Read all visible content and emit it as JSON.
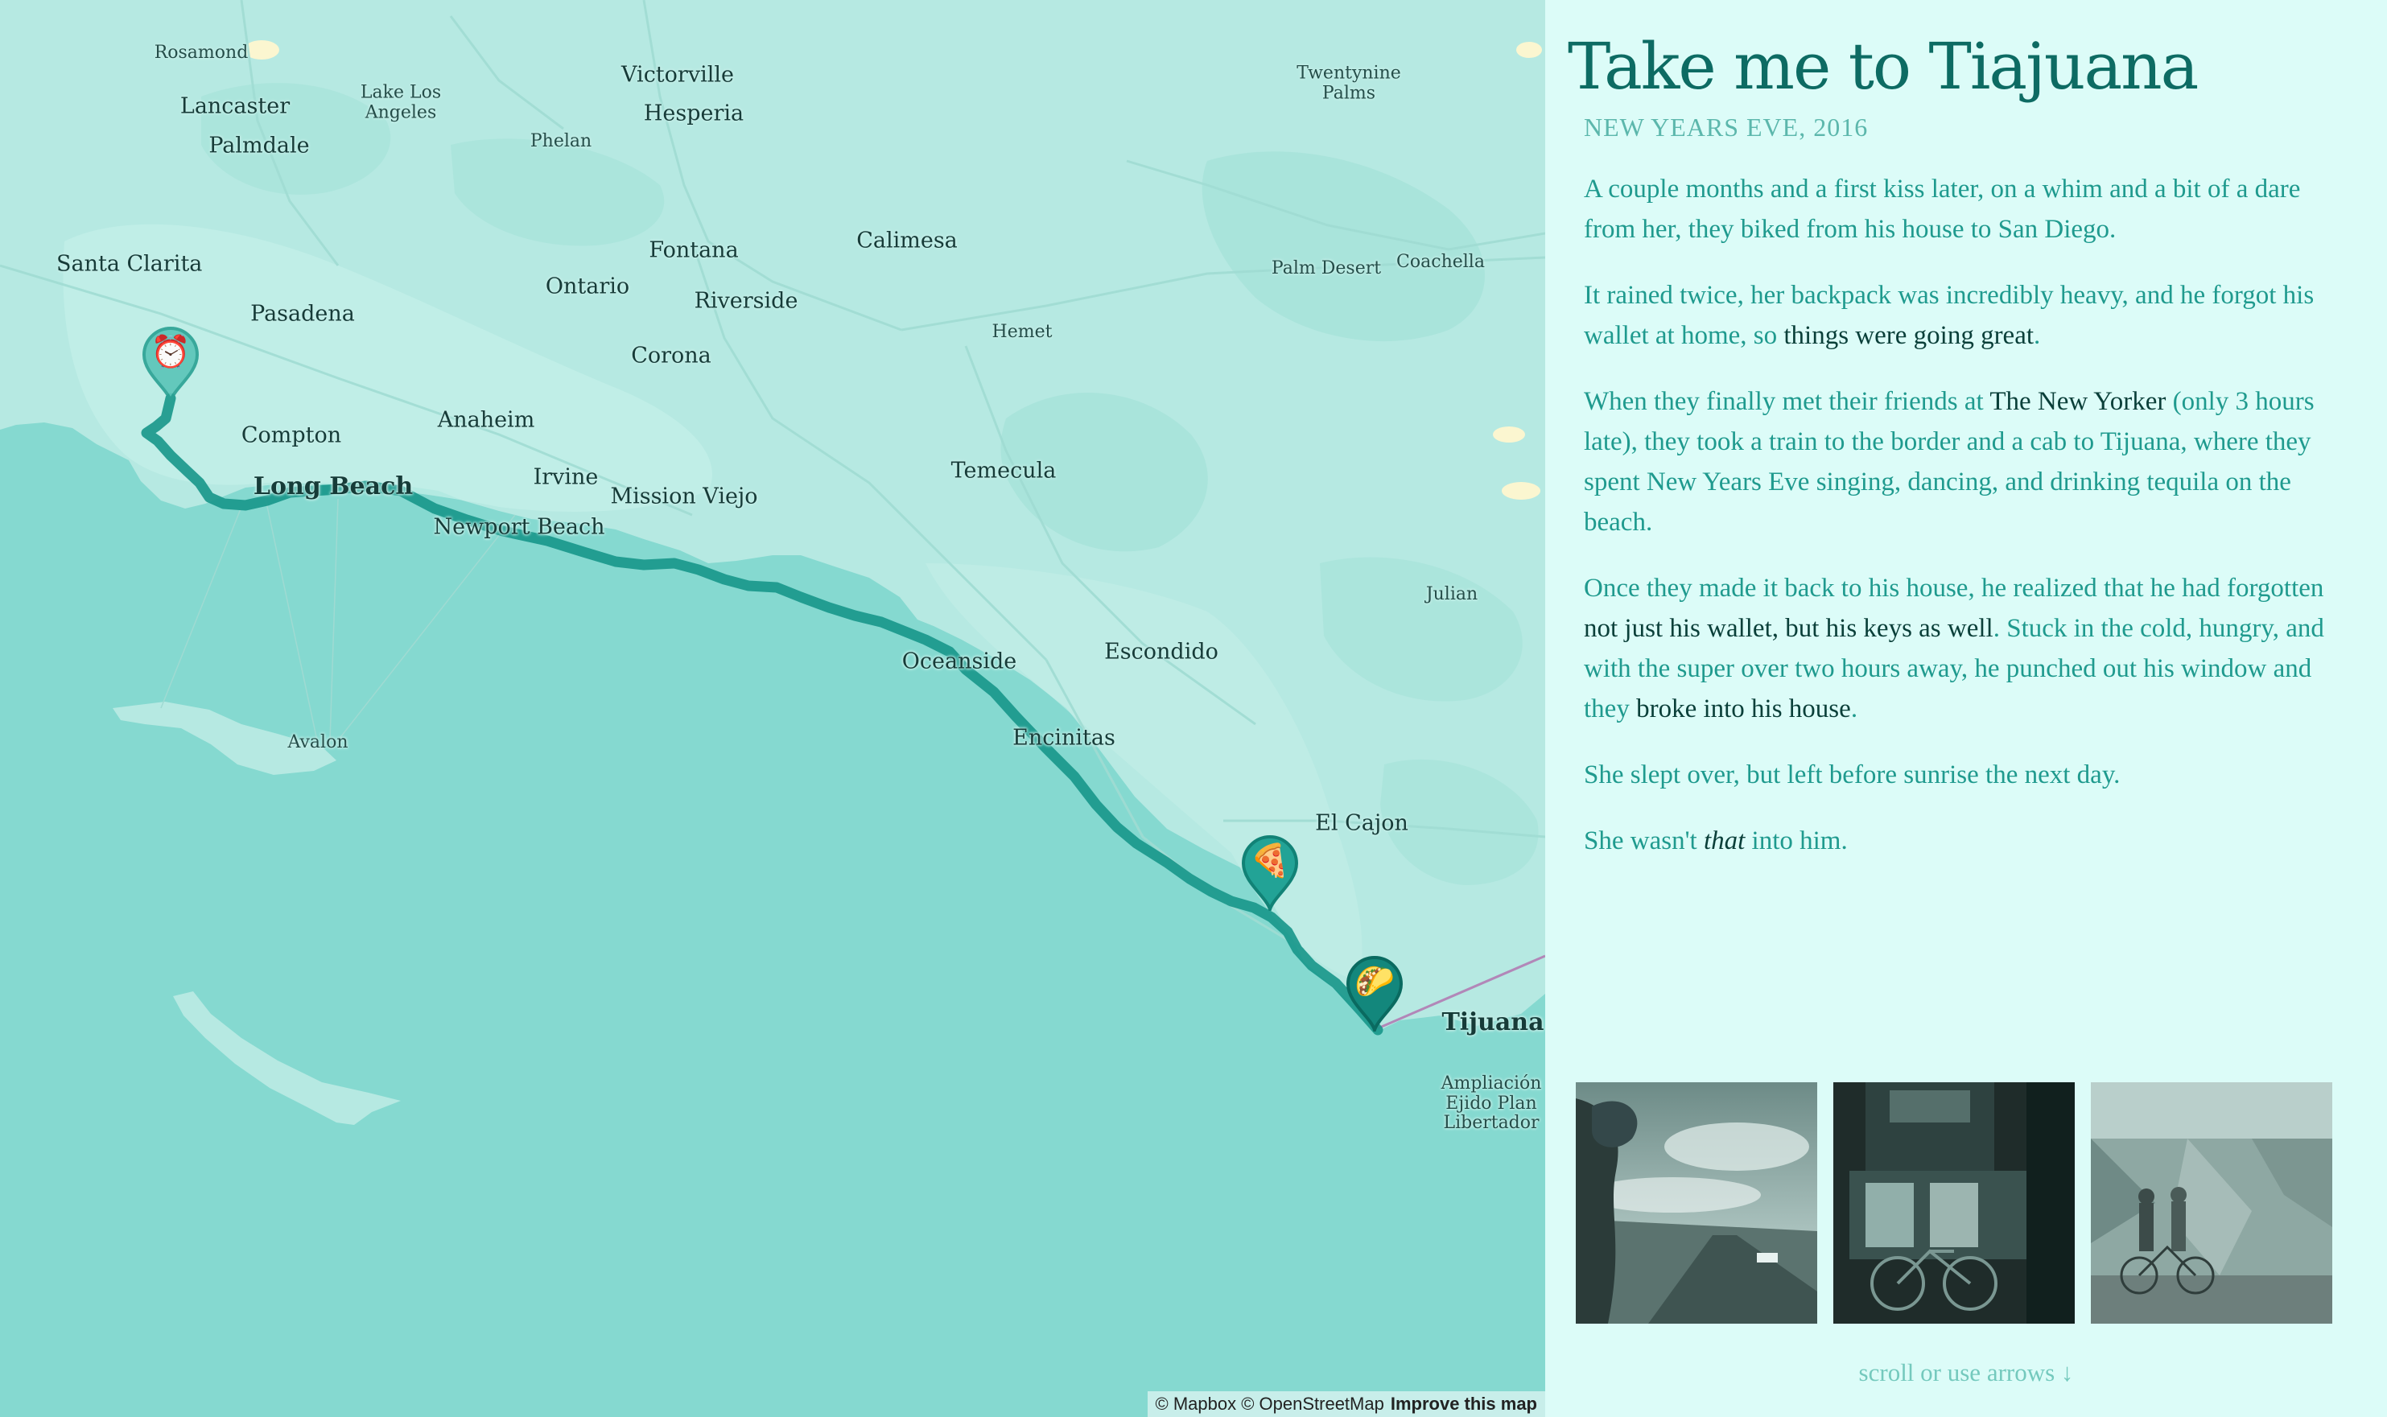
{
  "map": {
    "places": [
      {
        "name": "Rosamond",
        "size": "sm"
      },
      {
        "name": "Lancaster",
        "size": "md"
      },
      {
        "name": "Lake Los\nAngeles",
        "size": "sm"
      },
      {
        "name": "Victorville",
        "size": "md"
      },
      {
        "name": "Hesperia",
        "size": "md"
      },
      {
        "name": "Twentynine\nPalms",
        "size": "sm"
      },
      {
        "name": "Palmdale",
        "size": "md"
      },
      {
        "name": "Phelan",
        "size": "sm"
      },
      {
        "name": "Santa Clarita",
        "size": "md"
      },
      {
        "name": "Fontana",
        "size": "md"
      },
      {
        "name": "Calimesa",
        "size": "md"
      },
      {
        "name": "Palm Desert",
        "size": "sm"
      },
      {
        "name": "Coachella",
        "size": "sm"
      },
      {
        "name": "Pasadena",
        "size": "md"
      },
      {
        "name": "Ontario",
        "size": "md"
      },
      {
        "name": "Riverside",
        "size": "md"
      },
      {
        "name": "Hemet",
        "size": "sm"
      },
      {
        "name": "Corona",
        "size": "md"
      },
      {
        "name": "Compton",
        "size": "md"
      },
      {
        "name": "Anaheim",
        "size": "md"
      },
      {
        "name": "Long Beach",
        "size": "lg"
      },
      {
        "name": "Irvine",
        "size": "md"
      },
      {
        "name": "Mission Viejo",
        "size": "md"
      },
      {
        "name": "Temecula",
        "size": "md"
      },
      {
        "name": "Newport Beach",
        "size": "md"
      },
      {
        "name": "Julian",
        "size": "sm"
      },
      {
        "name": "Oceanside",
        "size": "md"
      },
      {
        "name": "Escondido",
        "size": "md"
      },
      {
        "name": "Avalon",
        "size": "sm"
      },
      {
        "name": "Encinitas",
        "size": "md"
      },
      {
        "name": "El Cajon",
        "size": "md"
      },
      {
        "name": "Tijuana",
        "size": "lg"
      },
      {
        "name": "Ampliación\nEjido Plan\nLibertador",
        "size": "sm"
      }
    ],
    "markers": [
      {
        "name": "alarm-clock-marker",
        "emoji": "⏰"
      },
      {
        "name": "pizza-marker",
        "emoji": "🍕"
      },
      {
        "name": "taco-marker",
        "emoji": "🌮"
      }
    ],
    "attribution": {
      "text": "© Mapbox © OpenStreetMap",
      "improve": "Improve this map"
    }
  },
  "story": {
    "title": "Take me to Tiajuana",
    "date": "NEW YEARS EVE, 2016",
    "paragraphs": [
      {
        "parts": [
          {
            "text": "A couple months and a first kiss later, on a whim and a bit of a dare from her, they biked from his house to San Diego."
          }
        ]
      },
      {
        "parts": [
          {
            "text": "It rained twice, her backpack was incredibly heavy, and he forgot his wallet at home, so "
          },
          {
            "text": "things were going great",
            "style": "strong"
          },
          {
            "text": "."
          }
        ]
      },
      {
        "parts": [
          {
            "text": "When they finally met their friends at "
          },
          {
            "text": "The New Yorker",
            "style": "strong"
          },
          {
            "text": " (only 3 hours late), they took a train to the border and a cab to Tijuana, where they spent New Years Eve singing, dancing, and drinking tequila on the beach."
          }
        ]
      },
      {
        "parts": [
          {
            "text": "Once they made it back to his house, he realized that he had forgotten "
          },
          {
            "text": "not just his wallet, but his keys as well",
            "style": "strong"
          },
          {
            "text": ". Stuck in the cold, hungry, and with the super over two hours away, he punched out his window and they "
          },
          {
            "text": "broke into his house",
            "style": "strong"
          },
          {
            "text": "."
          }
        ]
      },
      {
        "parts": [
          {
            "text": "She slept over, but left before sunrise the next day."
          }
        ]
      },
      {
        "parts": [
          {
            "text": "She wasn't "
          },
          {
            "text": "that",
            "style": "em"
          },
          {
            "text": " into him."
          }
        ]
      }
    ],
    "photos": [
      {
        "name": "photo-coastal-road"
      },
      {
        "name": "photo-night-storefront"
      },
      {
        "name": "photo-bikes-mural"
      }
    ],
    "scroll_hint": "scroll or use arrows ↓"
  },
  "colors": {
    "ocean": "#85d9d0",
    "land": "#b5e8e1",
    "route": "#17968a",
    "panel_bg": "#dcfcf8",
    "title": "#0d6b63",
    "body_text": "#1f9a8e",
    "strong_text": "#0a3f39"
  }
}
